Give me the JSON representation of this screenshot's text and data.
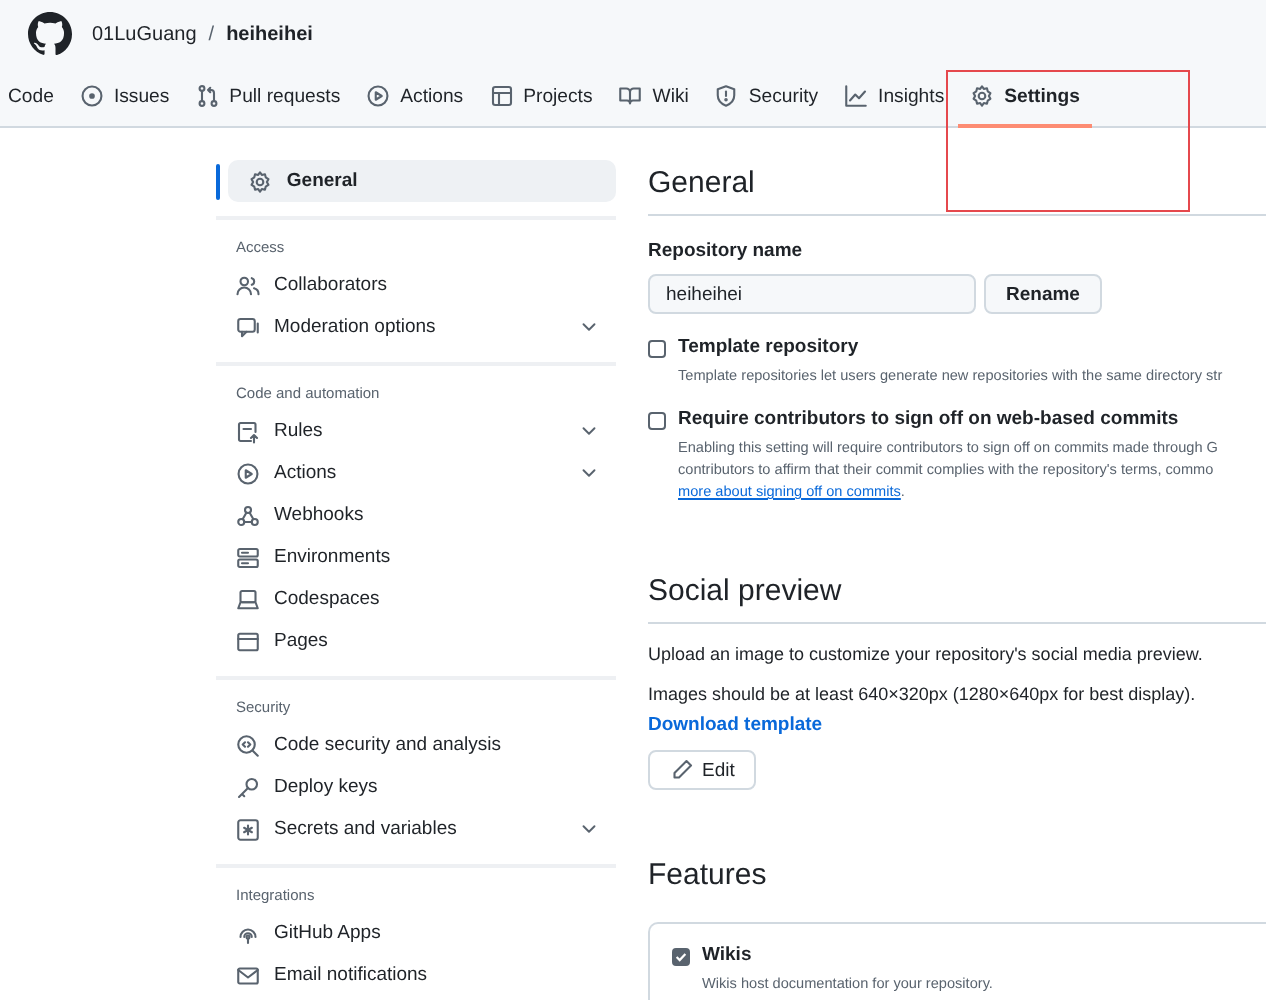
{
  "header": {
    "owner": "01LuGuang",
    "separator": "/",
    "repo": "heiheihei"
  },
  "nav": [
    {
      "label": "Code",
      "selected": false
    },
    {
      "label": "Issues",
      "selected": false
    },
    {
      "label": "Pull requests",
      "selected": false
    },
    {
      "label": "Actions",
      "selected": false
    },
    {
      "label": "Projects",
      "selected": false
    },
    {
      "label": "Wiki",
      "selected": false
    },
    {
      "label": "Security",
      "selected": false
    },
    {
      "label": "Insights",
      "selected": false
    },
    {
      "label": "Settings",
      "selected": true
    }
  ],
  "sidebar": {
    "top": {
      "label": "General",
      "selected": true
    },
    "sections": [
      {
        "heading": "Access",
        "items": [
          {
            "label": "Collaborators",
            "selected": false,
            "expandable": false
          },
          {
            "label": "Moderation options",
            "selected": false,
            "expandable": true
          }
        ]
      },
      {
        "heading": "Code and automation",
        "items": [
          {
            "label": "Rules",
            "selected": false,
            "expandable": true
          },
          {
            "label": "Actions",
            "selected": false,
            "expandable": true
          },
          {
            "label": "Webhooks",
            "selected": false,
            "expandable": false
          },
          {
            "label": "Environments",
            "selected": false,
            "expandable": false
          },
          {
            "label": "Codespaces",
            "selected": false,
            "expandable": false
          },
          {
            "label": "Pages",
            "selected": false,
            "expandable": false
          }
        ]
      },
      {
        "heading": "Security",
        "items": [
          {
            "label": "Code security and analysis",
            "selected": false,
            "expandable": false
          },
          {
            "label": "Deploy keys",
            "selected": false,
            "expandable": false
          },
          {
            "label": "Secrets and variables",
            "selected": false,
            "expandable": true
          }
        ]
      },
      {
        "heading": "Integrations",
        "items": [
          {
            "label": "GitHub Apps",
            "selected": false,
            "expandable": false
          },
          {
            "label": "Email notifications",
            "selected": false,
            "expandable": false
          }
        ]
      }
    ]
  },
  "general": {
    "title": "General",
    "repo_name_label": "Repository name",
    "repo_name_value": "heiheihei",
    "rename_button": "Rename",
    "options": [
      {
        "label": "Template repository",
        "checked": false,
        "description": [
          "Template repositories let users generate new repositories with the same directory str"
        ]
      },
      {
        "label": "Require contributors to sign off on web-based commits",
        "checked": false,
        "description": [
          "Enabling this setting will require contributors to sign off on commits made through G",
          "contributors to affirm that their commit complies with the repository's terms, commo"
        ],
        "link": "more about signing off on commits",
        "link_after": "."
      }
    ]
  },
  "social_preview": {
    "title": "Social preview",
    "text": "Upload an image to customize your repository's social media preview.",
    "hint": "Images should be at least 640×320px (1280×640px for best display).",
    "link": "Download template",
    "edit_button": "Edit"
  },
  "features": {
    "title": "Features",
    "items": [
      {
        "label": "Wikis",
        "checked": true,
        "description": "Wikis host documentation for your repository."
      }
    ]
  }
}
